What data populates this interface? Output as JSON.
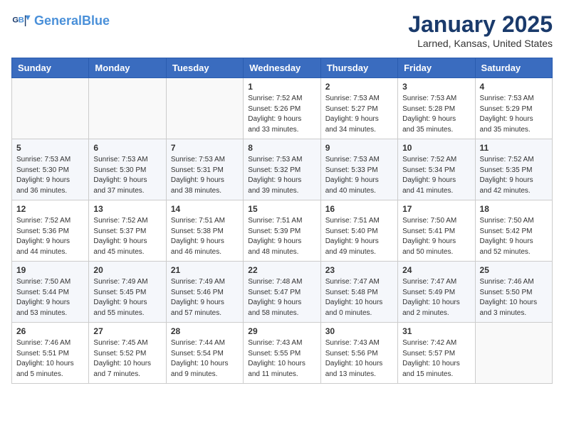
{
  "logo": {
    "line1": "General",
    "line2": "Blue"
  },
  "title": "January 2025",
  "location": "Larned, Kansas, United States",
  "weekdays": [
    "Sunday",
    "Monday",
    "Tuesday",
    "Wednesday",
    "Thursday",
    "Friday",
    "Saturday"
  ],
  "weeks": [
    [
      {
        "day": "",
        "info": ""
      },
      {
        "day": "",
        "info": ""
      },
      {
        "day": "",
        "info": ""
      },
      {
        "day": "1",
        "info": "Sunrise: 7:52 AM\nSunset: 5:26 PM\nDaylight: 9 hours\nand 33 minutes."
      },
      {
        "day": "2",
        "info": "Sunrise: 7:53 AM\nSunset: 5:27 PM\nDaylight: 9 hours\nand 34 minutes."
      },
      {
        "day": "3",
        "info": "Sunrise: 7:53 AM\nSunset: 5:28 PM\nDaylight: 9 hours\nand 35 minutes."
      },
      {
        "day": "4",
        "info": "Sunrise: 7:53 AM\nSunset: 5:29 PM\nDaylight: 9 hours\nand 35 minutes."
      }
    ],
    [
      {
        "day": "5",
        "info": "Sunrise: 7:53 AM\nSunset: 5:30 PM\nDaylight: 9 hours\nand 36 minutes."
      },
      {
        "day": "6",
        "info": "Sunrise: 7:53 AM\nSunset: 5:30 PM\nDaylight: 9 hours\nand 37 minutes."
      },
      {
        "day": "7",
        "info": "Sunrise: 7:53 AM\nSunset: 5:31 PM\nDaylight: 9 hours\nand 38 minutes."
      },
      {
        "day": "8",
        "info": "Sunrise: 7:53 AM\nSunset: 5:32 PM\nDaylight: 9 hours\nand 39 minutes."
      },
      {
        "day": "9",
        "info": "Sunrise: 7:53 AM\nSunset: 5:33 PM\nDaylight: 9 hours\nand 40 minutes."
      },
      {
        "day": "10",
        "info": "Sunrise: 7:52 AM\nSunset: 5:34 PM\nDaylight: 9 hours\nand 41 minutes."
      },
      {
        "day": "11",
        "info": "Sunrise: 7:52 AM\nSunset: 5:35 PM\nDaylight: 9 hours\nand 42 minutes."
      }
    ],
    [
      {
        "day": "12",
        "info": "Sunrise: 7:52 AM\nSunset: 5:36 PM\nDaylight: 9 hours\nand 44 minutes."
      },
      {
        "day": "13",
        "info": "Sunrise: 7:52 AM\nSunset: 5:37 PM\nDaylight: 9 hours\nand 45 minutes."
      },
      {
        "day": "14",
        "info": "Sunrise: 7:51 AM\nSunset: 5:38 PM\nDaylight: 9 hours\nand 46 minutes."
      },
      {
        "day": "15",
        "info": "Sunrise: 7:51 AM\nSunset: 5:39 PM\nDaylight: 9 hours\nand 48 minutes."
      },
      {
        "day": "16",
        "info": "Sunrise: 7:51 AM\nSunset: 5:40 PM\nDaylight: 9 hours\nand 49 minutes."
      },
      {
        "day": "17",
        "info": "Sunrise: 7:50 AM\nSunset: 5:41 PM\nDaylight: 9 hours\nand 50 minutes."
      },
      {
        "day": "18",
        "info": "Sunrise: 7:50 AM\nSunset: 5:42 PM\nDaylight: 9 hours\nand 52 minutes."
      }
    ],
    [
      {
        "day": "19",
        "info": "Sunrise: 7:50 AM\nSunset: 5:44 PM\nDaylight: 9 hours\nand 53 minutes."
      },
      {
        "day": "20",
        "info": "Sunrise: 7:49 AM\nSunset: 5:45 PM\nDaylight: 9 hours\nand 55 minutes."
      },
      {
        "day": "21",
        "info": "Sunrise: 7:49 AM\nSunset: 5:46 PM\nDaylight: 9 hours\nand 57 minutes."
      },
      {
        "day": "22",
        "info": "Sunrise: 7:48 AM\nSunset: 5:47 PM\nDaylight: 9 hours\nand 58 minutes."
      },
      {
        "day": "23",
        "info": "Sunrise: 7:47 AM\nSunset: 5:48 PM\nDaylight: 10 hours\nand 0 minutes."
      },
      {
        "day": "24",
        "info": "Sunrise: 7:47 AM\nSunset: 5:49 PM\nDaylight: 10 hours\nand 2 minutes."
      },
      {
        "day": "25",
        "info": "Sunrise: 7:46 AM\nSunset: 5:50 PM\nDaylight: 10 hours\nand 3 minutes."
      }
    ],
    [
      {
        "day": "26",
        "info": "Sunrise: 7:46 AM\nSunset: 5:51 PM\nDaylight: 10 hours\nand 5 minutes."
      },
      {
        "day": "27",
        "info": "Sunrise: 7:45 AM\nSunset: 5:52 PM\nDaylight: 10 hours\nand 7 minutes."
      },
      {
        "day": "28",
        "info": "Sunrise: 7:44 AM\nSunset: 5:54 PM\nDaylight: 10 hours\nand 9 minutes."
      },
      {
        "day": "29",
        "info": "Sunrise: 7:43 AM\nSunset: 5:55 PM\nDaylight: 10 hours\nand 11 minutes."
      },
      {
        "day": "30",
        "info": "Sunrise: 7:43 AM\nSunset: 5:56 PM\nDaylight: 10 hours\nand 13 minutes."
      },
      {
        "day": "31",
        "info": "Sunrise: 7:42 AM\nSunset: 5:57 PM\nDaylight: 10 hours\nand 15 minutes."
      },
      {
        "day": "",
        "info": ""
      }
    ]
  ]
}
